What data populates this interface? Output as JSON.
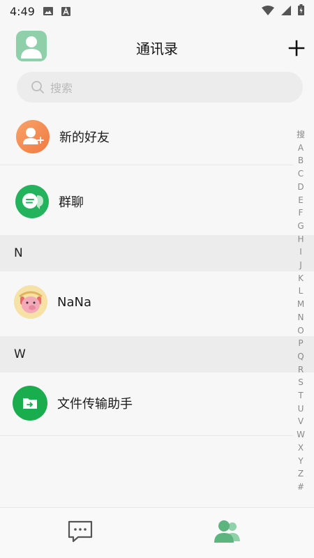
{
  "status_bar": {
    "time": "4:49"
  },
  "header": {
    "title": "通讯录"
  },
  "search": {
    "placeholder": "搜索"
  },
  "top_items": [
    {
      "label": "新的好友"
    },
    {
      "label": "群聊"
    }
  ],
  "sections": [
    {
      "letter": "N",
      "contacts": [
        {
          "name": "NaNa"
        }
      ]
    },
    {
      "letter": "W",
      "contacts": [
        {
          "name": "文件传输助手"
        }
      ]
    }
  ],
  "index_letters": [
    "搜",
    "A",
    "B",
    "C",
    "D",
    "E",
    "F",
    "G",
    "H",
    "I",
    "J",
    "K",
    "L",
    "M",
    "N",
    "O",
    "P",
    "Q",
    "R",
    "S",
    "T",
    "U",
    "V",
    "W",
    "X",
    "Y",
    "Z",
    "#"
  ],
  "colors": {
    "accent_green": "#5cb57f",
    "new_friend_orange": "#f2874a",
    "group_green": "#27b55f",
    "file_green": "#1aad4e"
  }
}
